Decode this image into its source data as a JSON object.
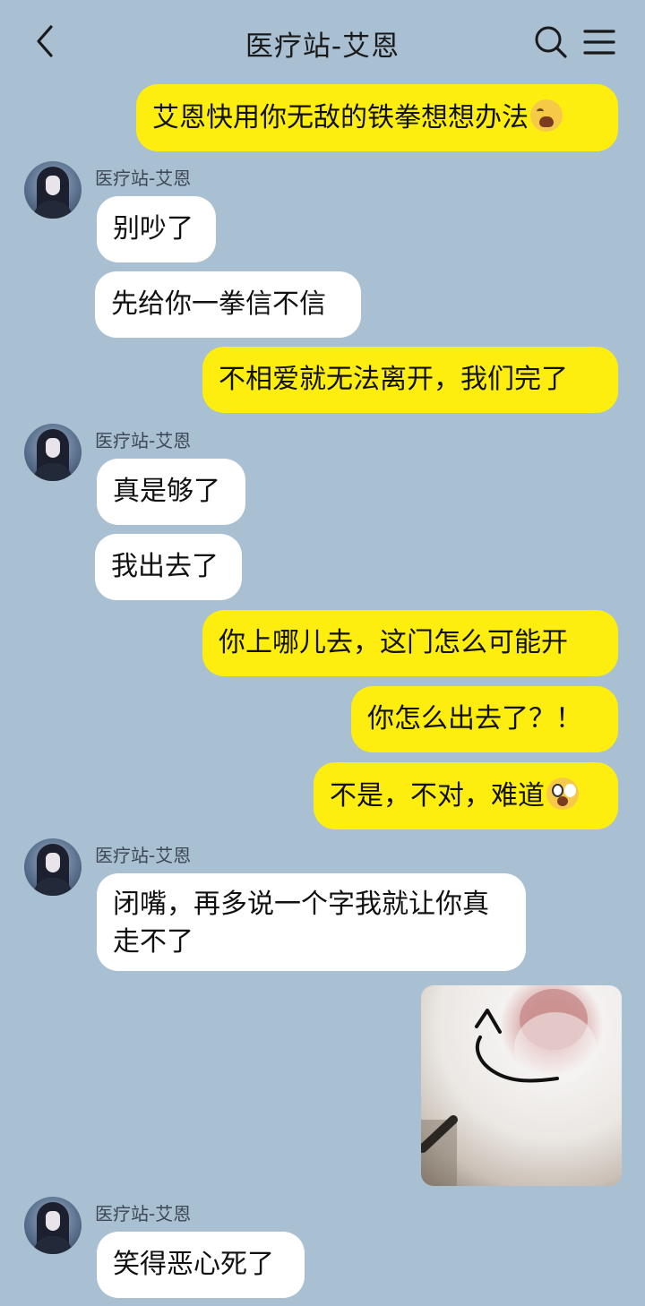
{
  "header": {
    "title": "医疗站-艾恩",
    "back_icon": "chevron-left-icon",
    "search_icon": "search-icon",
    "menu_icon": "menu-icon"
  },
  "colors": {
    "background": "#a9bfd2",
    "outgoing_bubble": "#fdee10",
    "incoming_bubble": "#ffffff"
  },
  "messages": [
    {
      "direction": "out",
      "text": "艾恩快用你无敌的铁拳想想办法",
      "emoji": "loudly-crying-face"
    },
    {
      "direction": "in",
      "sender": "医疗站-艾恩",
      "text": "别吵了"
    },
    {
      "direction": "in",
      "text": "先给你一拳信不信"
    },
    {
      "direction": "out",
      "text": "不相爱就无法离开，我们完了"
    },
    {
      "direction": "in",
      "sender": "医疗站-艾恩",
      "text": "真是够了"
    },
    {
      "direction": "in",
      "text": "我出去了"
    },
    {
      "direction": "out",
      "text": "你上哪儿去，这门怎么可能开"
    },
    {
      "direction": "out",
      "text": "你怎么出去了？！"
    },
    {
      "direction": "out",
      "text": "不是，不对，难道",
      "emoji": "screaming-face"
    },
    {
      "direction": "in",
      "sender": "医疗站-艾恩",
      "text": "闭嘴，再多说一个字我就让你真走不了"
    },
    {
      "direction": "out",
      "image": "photo-white-cat-nose-with-drawn-arrow"
    },
    {
      "direction": "in",
      "sender": "医疗站-艾恩",
      "text": "笑得恶心死了"
    }
  ]
}
